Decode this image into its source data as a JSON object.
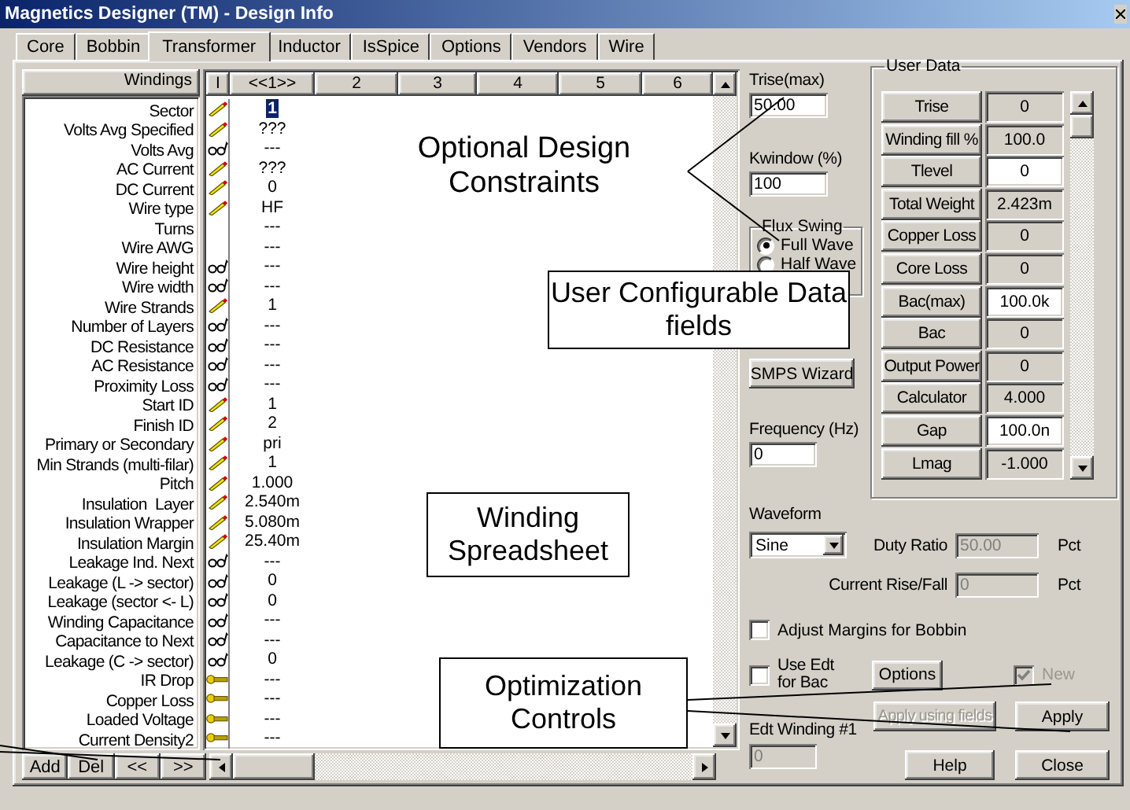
{
  "window": {
    "title": "Magnetics Designer (TM) - Design Info"
  },
  "tabs": [
    {
      "label": "Core",
      "selected": false
    },
    {
      "label": "Bobbin",
      "selected": false
    },
    {
      "label": "Transformer",
      "selected": true
    },
    {
      "label": "Inductor",
      "selected": false
    },
    {
      "label": "IsSpice",
      "selected": false
    },
    {
      "label": "Options",
      "selected": false
    },
    {
      "label": "Vendors",
      "selected": false
    },
    {
      "label": "Wire",
      "selected": false
    }
  ],
  "windings": {
    "header": "Windings",
    "columns": [
      "I",
      "<<1>>",
      "2",
      "3",
      "4",
      "5",
      "6"
    ],
    "rows": [
      {
        "label": "Sector",
        "kind": "edit",
        "value": "1",
        "selected": true
      },
      {
        "label": "Volts Avg Specified",
        "kind": "edit",
        "value": "???",
        "selected": false
      },
      {
        "label": "Volts Avg",
        "kind": "view",
        "value": "---",
        "selected": false
      },
      {
        "label": "AC Current",
        "kind": "edit",
        "value": "???",
        "selected": false
      },
      {
        "label": "DC Current",
        "kind": "edit",
        "value": "0",
        "selected": false
      },
      {
        "label": "Wire type",
        "kind": "edit",
        "value": "HF",
        "selected": false
      },
      {
        "label": "Turns",
        "kind": "none",
        "value": "---",
        "selected": false
      },
      {
        "label": "Wire AWG",
        "kind": "none",
        "value": "---",
        "selected": false
      },
      {
        "label": "Wire height",
        "kind": "view",
        "value": "---",
        "selected": false
      },
      {
        "label": "Wire width",
        "kind": "view",
        "value": "---",
        "selected": false
      },
      {
        "label": "Wire Strands",
        "kind": "edit",
        "value": "1",
        "selected": false
      },
      {
        "label": "Number of Layers",
        "kind": "view",
        "value": "---",
        "selected": false
      },
      {
        "label": "DC Resistance",
        "kind": "view",
        "value": "---",
        "selected": false
      },
      {
        "label": "AC Resistance",
        "kind": "view",
        "value": "---",
        "selected": false
      },
      {
        "label": "Proximity Loss",
        "kind": "view",
        "value": "---",
        "selected": false
      },
      {
        "label": "Start ID",
        "kind": "edit",
        "value": "1",
        "selected": false
      },
      {
        "label": "Finish ID",
        "kind": "edit",
        "value": "2",
        "selected": false
      },
      {
        "label": "Primary or Secondary",
        "kind": "edit",
        "value": "pri",
        "selected": false
      },
      {
        "label": "Min Strands (multi-filar)",
        "kind": "edit",
        "value": "1",
        "selected": false
      },
      {
        "label": "Pitch",
        "kind": "edit",
        "value": "1.000",
        "selected": false
      },
      {
        "label": "Insulation  Layer",
        "kind": "edit",
        "value": "2.540m",
        "selected": false
      },
      {
        "label": "Insulation Wrapper",
        "kind": "edit",
        "value": "5.080m",
        "selected": false
      },
      {
        "label": "Insulation Margin",
        "kind": "edit",
        "value": "25.40m",
        "selected": false
      },
      {
        "label": "Leakage Ind. Next",
        "kind": "view",
        "value": "---",
        "selected": false
      },
      {
        "label": "Leakage (L -> sector)",
        "kind": "view",
        "value": "0",
        "selected": false
      },
      {
        "label": "Leakage (sector <- L)",
        "kind": "view",
        "value": "0",
        "selected": false
      },
      {
        "label": "Winding Capacitance",
        "kind": "view",
        "value": "---",
        "selected": false
      },
      {
        "label": "Capacitance to Next",
        "kind": "view",
        "value": "---",
        "selected": false
      },
      {
        "label": "Leakage (C -> sector)",
        "kind": "view",
        "value": "0",
        "selected": false
      },
      {
        "label": "IR Drop",
        "kind": "key",
        "value": "---",
        "selected": false
      },
      {
        "label": "Copper Loss",
        "kind": "key",
        "value": "---",
        "selected": false
      },
      {
        "label": "Loaded Voltage",
        "kind": "key",
        "value": "---",
        "selected": false
      },
      {
        "label": "Current Density2",
        "kind": "key",
        "value": "---",
        "selected": false
      }
    ],
    "buttons": [
      "Add",
      "Del",
      "<<",
      ">>"
    ]
  },
  "constraints": {
    "trise_max": {
      "label": "Trise(max)",
      "value": "50.00"
    },
    "kwindow": {
      "label": "Kwindow (%)",
      "value": "100"
    },
    "flux_swing": {
      "title": "Flux Swing",
      "options": [
        {
          "label": "Full Wave",
          "selected": true
        },
        {
          "label": "Half Wave",
          "selected": false
        }
      ]
    },
    "smps_button": "SMPS Wizard",
    "frequency": {
      "label": "Frequency (Hz)",
      "value": "0"
    }
  },
  "user_data": {
    "title": "User Data",
    "rows": [
      {
        "label": "Trise",
        "value": "0",
        "editable": false
      },
      {
        "label": "Winding fill %",
        "value": "100.0",
        "editable": false
      },
      {
        "label": "Tlevel",
        "value": "0",
        "editable": true
      },
      {
        "label": "Total Weight",
        "value": "2.423m",
        "editable": false
      },
      {
        "label": "Copper Loss",
        "value": "0",
        "editable": false
      },
      {
        "label": "Core Loss",
        "value": "0",
        "editable": false
      },
      {
        "label": "Bac(max)",
        "value": "100.0k",
        "editable": true
      },
      {
        "label": "Bac",
        "value": "0",
        "editable": false
      },
      {
        "label": "Output Power",
        "value": "0",
        "editable": false
      },
      {
        "label": "Calculator",
        "value": "4.000",
        "editable": false
      },
      {
        "label": "Gap",
        "value": "100.0n",
        "editable": true
      },
      {
        "label": "Lmag",
        "value": "-1.000",
        "editable": false
      }
    ]
  },
  "waveform": {
    "label": "Waveform",
    "value": "Sine"
  },
  "duty_ratio": {
    "label": "Duty Ratio",
    "value": "50.00",
    "unit": "Pct",
    "disabled": true
  },
  "rise_fall": {
    "label": "Current Rise/Fall",
    "value": "0",
    "unit": "Pct",
    "disabled": true
  },
  "adjust_margins": {
    "label": "Adjust Margins for Bobbin",
    "checked": false
  },
  "use_edt": {
    "label": "Use Edt for Bac",
    "checked": false
  },
  "options_button": "Options",
  "new_checkbox": {
    "label": "New",
    "checked": true,
    "disabled": true
  },
  "edt_winding": {
    "label": "Edt Winding #1",
    "value": "0",
    "disabled": true
  },
  "actions": [
    {
      "label": "Apply using fields",
      "disabled": true
    },
    {
      "label": "Apply",
      "disabled": false
    },
    {
      "label": "Help",
      "disabled": false
    },
    {
      "label": "Close",
      "disabled": false
    }
  ],
  "callouts": [
    {
      "text": "Optional Design Constraints",
      "kind": "plain"
    },
    {
      "text": "User Configurable Data fields",
      "kind": "boxed"
    },
    {
      "text": "Winding Spreadsheet",
      "kind": "boxed"
    },
    {
      "text": "Optimization Controls",
      "kind": "boxed"
    }
  ]
}
